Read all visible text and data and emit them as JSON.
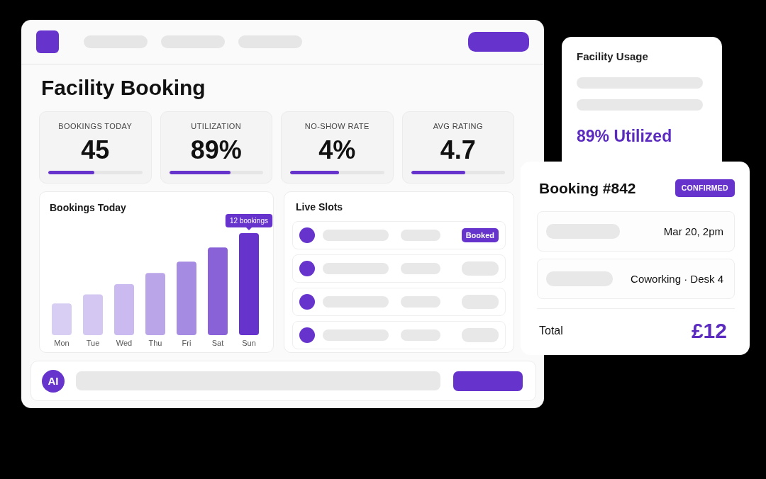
{
  "main_window": {
    "title": "Facility Booking",
    "stats": [
      {
        "label": "BOOKINGS TODAY",
        "value": "45",
        "level": 0.49
      },
      {
        "label": "UTILIZATION",
        "value": "89%",
        "level": 0.65
      },
      {
        "label": "NO-SHOW RATE",
        "value": "4%",
        "level": 0.52
      },
      {
        "label": "AVG RATING",
        "value": "4.7",
        "level": 0.58
      }
    ],
    "bookings_chart": {
      "title": "Bookings Today",
      "days": [
        "Mon",
        "Tue",
        "Wed",
        "Thu",
        "Fri",
        "Sat",
        "Sun"
      ],
      "tooltip": "12 bookings"
    },
    "live_slots": {
      "title": "Live Slots",
      "rows": [
        {
          "kind": "booked",
          "status": "Booked"
        },
        {
          "kind": "placeholder"
        },
        {
          "kind": "placeholder"
        },
        {
          "kind": "placeholder"
        }
      ]
    },
    "assistant_bar": {
      "avatar": "AI"
    }
  },
  "facility_usage": {
    "title": "Facility Usage",
    "summary": "89% Utilized"
  },
  "booking_card": {
    "title": "Booking #842",
    "status": "CONFIRMED",
    "details": [
      {
        "value": "Mar 20, 2pm"
      },
      {
        "value": "Coworking · Desk 4"
      }
    ],
    "total_label": "Total",
    "total": "£12"
  }
}
